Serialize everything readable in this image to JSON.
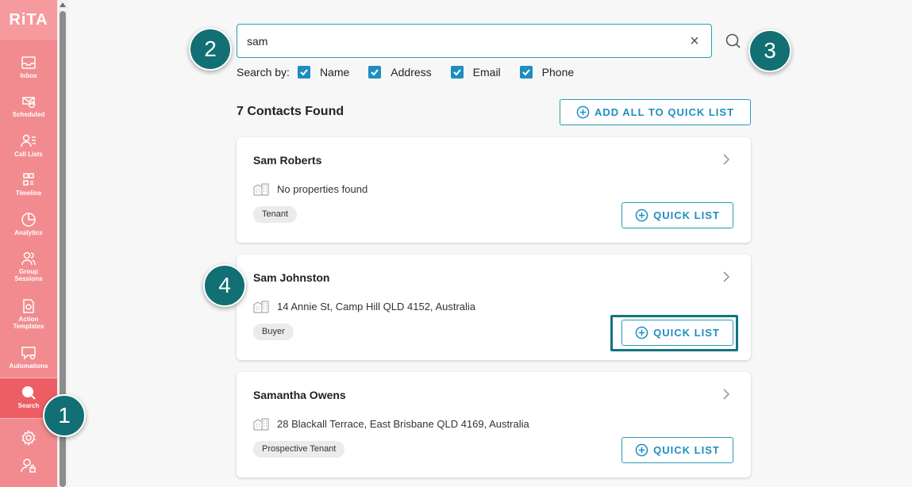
{
  "app": {
    "logo": "RiTA"
  },
  "sidebar": {
    "items": [
      {
        "label": "Inbox",
        "icon": "inbox-icon"
      },
      {
        "label": "Scheduled",
        "icon": "scheduled-icon"
      },
      {
        "label": "Call Lists",
        "icon": "call-lists-icon"
      },
      {
        "label": "Timeline",
        "icon": "timeline-icon"
      },
      {
        "label": "Analytics",
        "icon": "analytics-icon"
      },
      {
        "label": "Group Sessions",
        "icon": "group-sessions-icon"
      },
      {
        "label": "Action Templates",
        "icon": "action-templates-icon"
      },
      {
        "label": "Automations",
        "icon": "automations-icon"
      },
      {
        "label": "Search",
        "icon": "search-icon"
      }
    ],
    "active": "Search"
  },
  "search": {
    "value": "sam",
    "search_by_label": "Search by:",
    "options": [
      {
        "label": "Name",
        "checked": true
      },
      {
        "label": "Address",
        "checked": true
      },
      {
        "label": "Email",
        "checked": true
      },
      {
        "label": "Phone",
        "checked": true
      }
    ]
  },
  "results": {
    "count_text": "7 Contacts Found",
    "add_all_label": "ADD ALL TO QUICK LIST",
    "contacts": [
      {
        "name": "Sam Roberts",
        "address": "No properties found",
        "tag": "Tenant",
        "button": "QUICK LIST"
      },
      {
        "name": "Sam Johnston",
        "address": "14 Annie St, Camp Hill QLD 4152, Australia",
        "tag": "Buyer",
        "button": "QUICK LIST"
      },
      {
        "name": "Samantha Owens",
        "address": "28 Blackall Terrace, East Brisbane QLD 4169, Australia",
        "tag": "Prospective Tenant",
        "button": "QUICK LIST"
      }
    ]
  },
  "callouts": [
    "1",
    "2",
    "3",
    "4"
  ],
  "colors": {
    "sidebar": "#f28b8f",
    "accent": "#1f8dbf",
    "callout": "#126f73"
  }
}
